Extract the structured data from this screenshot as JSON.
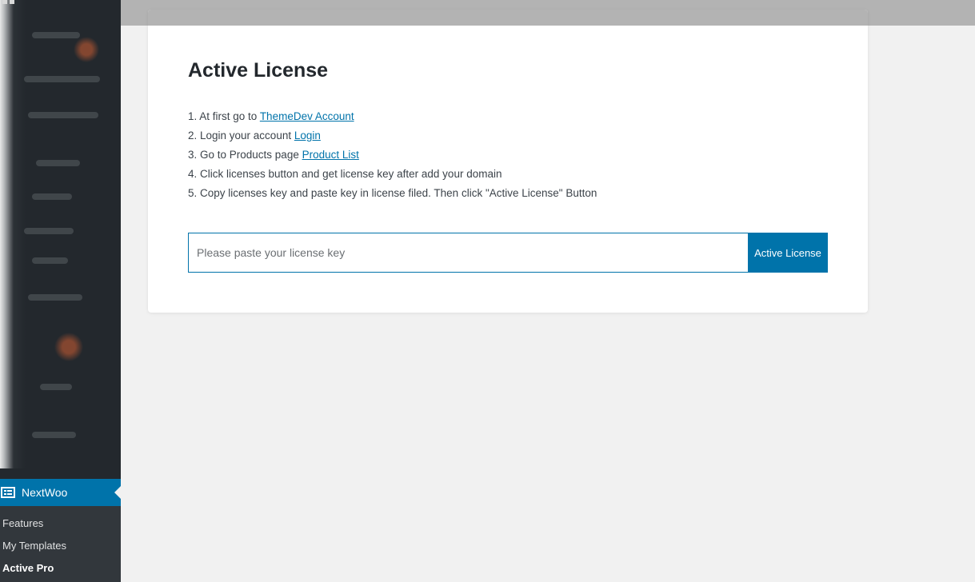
{
  "sidebar": {
    "active_menu": {
      "label": "NextWoo",
      "icon": "table-layout-icon"
    },
    "submenu": [
      {
        "label": "Features"
      },
      {
        "label": "My Templates"
      },
      {
        "label": "Active Pro"
      }
    ]
  },
  "license_card": {
    "title": "Active License",
    "steps": [
      {
        "text": "1. At first go to ",
        "link": "ThemeDev Account"
      },
      {
        "text": "2. Login your account ",
        "link": "Login"
      },
      {
        "text": "3. Go to Products page ",
        "link": "Product List"
      },
      {
        "text": "4. Click licenses button and get license key after add your domain",
        "link": ""
      },
      {
        "text": "5. Copy licenses key and paste key in license filed. Then click \"Active License\" Button",
        "link": ""
      }
    ],
    "input": {
      "value": "",
      "placeholder": "Please paste your license key"
    },
    "button_label": "Active License"
  },
  "colors": {
    "accent": "#0073aa",
    "sidebar_bg": "#23282d",
    "submenu_bg": "#32373c",
    "page_bg": "#f1f1f1"
  }
}
